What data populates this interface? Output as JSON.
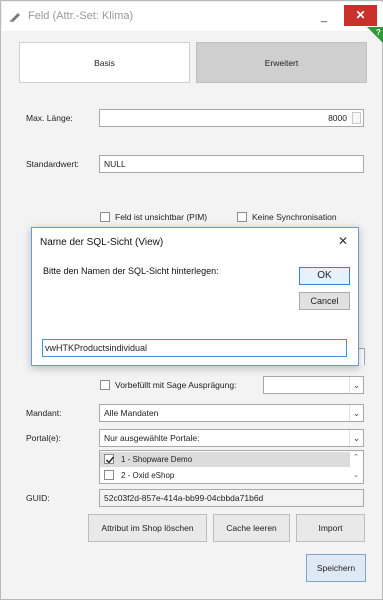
{
  "window": {
    "title": "Feld (Attr.-Set: Klima)",
    "minimize": "_",
    "close": "✕"
  },
  "tabs": {
    "basis": "Basis",
    "erweitert": "Erweitert"
  },
  "fields": {
    "max_laenge_label": "Max. Länge:",
    "max_laenge_value": "8000",
    "standardwert_label": "Standardwert:",
    "standardwert_value": "NULL",
    "unsichtbar_label": "Feld ist unsichtbar (PIM)",
    "keine_sync_label": "Keine Synchronisation",
    "vorbefuellt_label": "Vorbefüllt mit Sage Ausprägung:",
    "mandant_label": "Mandant:",
    "mandant_value": "Alle Mandaten",
    "portale_label": "Portal(e):",
    "portale_value": "Nur ausgewählte Portale:",
    "guid_label": "GUID:",
    "guid_value": "52c03f2d-857e-414a-bb99-04cbbda71b6d"
  },
  "portal_list": [
    {
      "label": "1 - Shopware Demo",
      "checked": true
    },
    {
      "label": "2 - Oxid eShop",
      "checked": false
    }
  ],
  "buttons": {
    "attribut_loeschen": "Attribut im Shop löschen",
    "cache_leeren": "Cache leeren",
    "import": "Import",
    "speichern": "Speichern"
  },
  "dialog": {
    "title": "Name der SQL-Sicht (View)",
    "message": "Bitte den Namen der SQL-Sicht hinterlegen:",
    "ok": "OK",
    "cancel": "Cancel",
    "input_value": "vwHTKProductsindividual"
  }
}
